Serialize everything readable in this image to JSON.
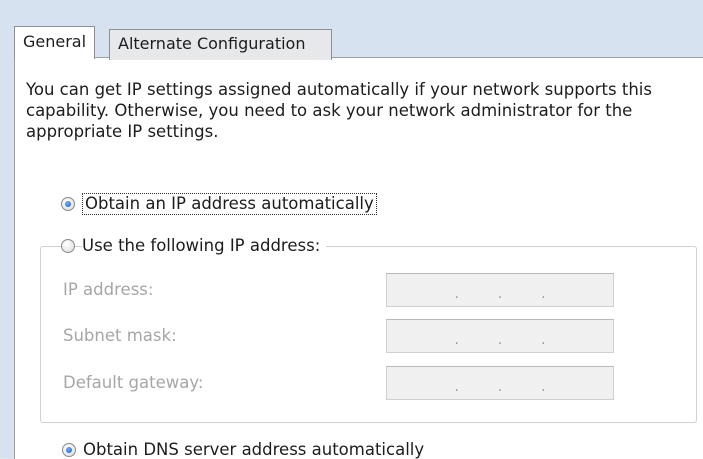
{
  "tabs": [
    {
      "label": "General",
      "active": true
    },
    {
      "label": "Alternate Configuration",
      "active": false
    }
  ],
  "description": "You can get IP settings assigned automatically if your network supports this capability. Otherwise, you need to ask your network administrator for the appropriate IP settings.",
  "ip_options": {
    "auto_label": "Obtain an IP address automatically",
    "manual_label": "Use the following IP address:",
    "selected": "auto"
  },
  "fields": [
    {
      "label": "IP address:",
      "value": ". . ."
    },
    {
      "label": "Subnet mask:",
      "value": ". . ."
    },
    {
      "label": "Default gateway:",
      "value": ". . ."
    }
  ],
  "dns_options": {
    "auto_label": "Obtain DNS server address automatically"
  },
  "colors": {
    "accent_radio": "#1a58b8",
    "disabled_text": "#a6a6a6"
  }
}
